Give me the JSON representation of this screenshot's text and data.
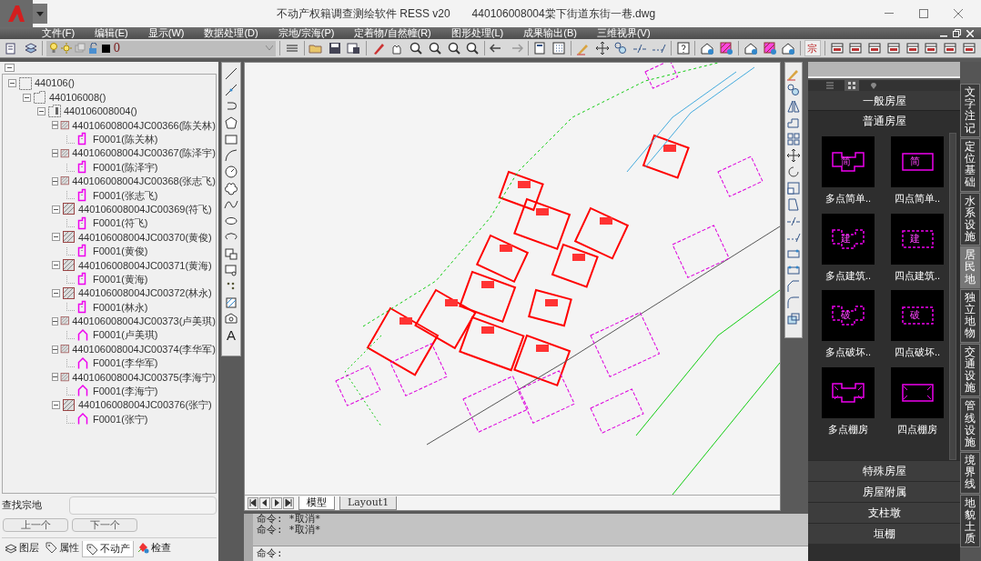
{
  "window": {
    "title": "不动产权籍调查测绘软件 RESS v20　　440106008004棠下街道东街一巷.dwg"
  },
  "menu": [
    "文件(F)",
    "编辑(E)",
    "显示(W)",
    "数据处理(D)",
    "宗地/宗海(P)",
    "定着物/自然幢(R)",
    "图形处理(L)",
    "成果输出(B)",
    "三维视界(V)"
  ],
  "layer_combo": {
    "value": "0"
  },
  "toolbar_text_button": "宗",
  "tree": [
    {
      "label": "440106()",
      "kind": "district",
      "expanded": true,
      "children": [
        {
          "label": "440106008()",
          "kind": "street",
          "expanded": true,
          "children": [
            {
              "label": "440106008004()",
              "kind": "block",
              "expanded": true,
              "children": [
                {
                  "label": "440106008004JC00366(陈关林)",
                  "kind": "parcel",
                  "expanded": true,
                  "children": [
                    {
                      "label": "F0001(陈关林)",
                      "kind": "house"
                    }
                  ]
                },
                {
                  "label": "440106008004JC00367(陈泽宇)",
                  "kind": "parcel",
                  "expanded": true,
                  "children": [
                    {
                      "label": "F0001(陈泽宇)",
                      "kind": "house"
                    }
                  ]
                },
                {
                  "label": "440106008004JC00368(张志飞)",
                  "kind": "parcel",
                  "expanded": true,
                  "children": [
                    {
                      "label": "F0001(张志飞)",
                      "kind": "house"
                    }
                  ]
                },
                {
                  "label": "440106008004JC00369(符飞)",
                  "kind": "parcel",
                  "expanded": true,
                  "children": [
                    {
                      "label": "F0001(符飞)",
                      "kind": "house"
                    }
                  ]
                },
                {
                  "label": "440106008004JC00370(黄俊)",
                  "kind": "parcel",
                  "expanded": true,
                  "children": [
                    {
                      "label": "F0001(黄俊)",
                      "kind": "house"
                    }
                  ]
                },
                {
                  "label": "440106008004JC00371(黄海)",
                  "kind": "parcel",
                  "expanded": true,
                  "children": [
                    {
                      "label": "F0001(黄海)",
                      "kind": "house"
                    }
                  ]
                },
                {
                  "label": "440106008004JC00372(林永)",
                  "kind": "parcel",
                  "expanded": true,
                  "children": [
                    {
                      "label": "F0001(林永)",
                      "kind": "house"
                    }
                  ]
                },
                {
                  "label": "440106008004JC00373(卢美琪)",
                  "kind": "parcel",
                  "expanded": true,
                  "children": [
                    {
                      "label": "F0001(卢美琪)",
                      "kind": "house2"
                    }
                  ]
                },
                {
                  "label": "440106008004JC00374(李华军)",
                  "kind": "parcel",
                  "expanded": true,
                  "children": [
                    {
                      "label": "F0001(李华军)",
                      "kind": "house2"
                    }
                  ]
                },
                {
                  "label": "440106008004JC00375(李海宁)",
                  "kind": "parcel",
                  "expanded": true,
                  "children": [
                    {
                      "label": "F0001(李海宁)",
                      "kind": "house2"
                    }
                  ]
                },
                {
                  "label": "440106008004JC00376(张宁)",
                  "kind": "parcel",
                  "expanded": true,
                  "children": [
                    {
                      "label": "F0001(张宁)",
                      "kind": "house2"
                    }
                  ]
                }
              ]
            }
          ]
        }
      ]
    }
  ],
  "find": {
    "label": "查找宗地"
  },
  "nav_buttons": [
    "上一个",
    "下一个"
  ],
  "panel_tabs": [
    {
      "label": "图层",
      "kind": "layers",
      "selected": false
    },
    {
      "label": "属性",
      "kind": "tag",
      "selected": false
    },
    {
      "label": "不动产",
      "kind": "tag",
      "selected": true
    },
    {
      "label": "检查",
      "kind": "check",
      "selected": false
    }
  ],
  "draw_toolbar_text_tool": "A",
  "layout_tabs": [
    {
      "label": "模型",
      "selected": true
    },
    {
      "label": "Layout1",
      "selected": false
    }
  ],
  "command": {
    "history": [
      "命令: *取消*",
      "命令: *取消*"
    ],
    "prompt": "命令:"
  },
  "palette": {
    "view_tabs": [
      {
        "kind": "list",
        "selected": false
      },
      {
        "kind": "grid",
        "selected": true
      },
      {
        "kind": "pin",
        "selected": false
      }
    ],
    "section": "一般房屋",
    "group": {
      "title": "普通房屋",
      "expanded": true
    },
    "items": [
      {
        "label": "多点简单..",
        "kind": "multi_solid",
        "glyph": "简"
      },
      {
        "label": "四点简单..",
        "kind": "four_solid",
        "glyph": "简"
      },
      {
        "label": "多点建筑..",
        "kind": "multi_dashed",
        "glyph": "建"
      },
      {
        "label": "四点建筑..",
        "kind": "four_dashed",
        "glyph": "建"
      },
      {
        "label": "多点破坏..",
        "kind": "multi_dashed",
        "glyph": "破"
      },
      {
        "label": "四点破坏..",
        "kind": "four_dashed",
        "glyph": "破"
      },
      {
        "label": "多点棚房",
        "kind": "multi_shed"
      },
      {
        "label": "四点棚房",
        "kind": "four_shed"
      }
    ],
    "collapsed_groups": [
      "特殊房屋",
      "房屋附属",
      "支柱墩",
      "垣棚"
    ],
    "side_tabs": [
      {
        "label": "文字注记",
        "selected": false
      },
      {
        "label": "定位基础",
        "selected": false
      },
      {
        "label": "水系设施",
        "selected": false
      },
      {
        "label": "居民地",
        "selected": true
      },
      {
        "label": "独立地物",
        "selected": false
      },
      {
        "label": "交通设施",
        "selected": false
      },
      {
        "label": "管线设施",
        "selected": false
      },
      {
        "label": "境界线",
        "selected": false
      },
      {
        "label": "地貌土质",
        "selected": false
      }
    ]
  }
}
